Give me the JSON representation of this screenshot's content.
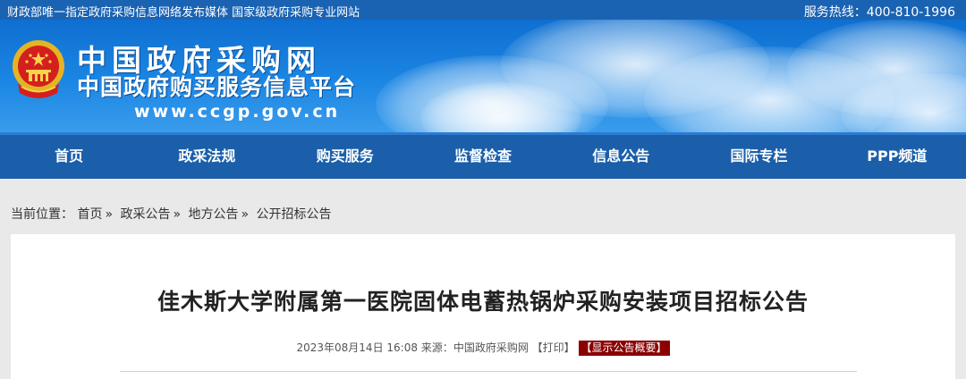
{
  "topbar": {
    "left_text": "财政部唯一指定政府采购信息网络发布媒体 国家级政府采购专业网站",
    "hotline": "服务热线：400-810-1996"
  },
  "header": {
    "title": "中国政府采购网",
    "subtitle": "中国政府购买服务信息平台",
    "url": "www.ccgp.gov.cn"
  },
  "nav": {
    "items": [
      "首页",
      "政采法规",
      "购买服务",
      "监督检查",
      "信息公告",
      "国际专栏",
      "PPP频道"
    ]
  },
  "breadcrumb": {
    "label": "当前位置：",
    "items": [
      "首页",
      "政采公告",
      "地方公告",
      "公开招标公告"
    ],
    "separator": "»"
  },
  "article": {
    "title": "佳木斯大学附属第一医院固体电蓄热锅炉采购安装项目招标公告",
    "date": "2023年08月14日 16:08",
    "source_label": "来源：",
    "source": "中国政府采购网",
    "print_label": "【打印】",
    "summary_button": "【显示公告概要】"
  },
  "colors": {
    "topbar": "#1a63b3",
    "nav": "#1b5faa",
    "summary_button": "#8b0000"
  }
}
